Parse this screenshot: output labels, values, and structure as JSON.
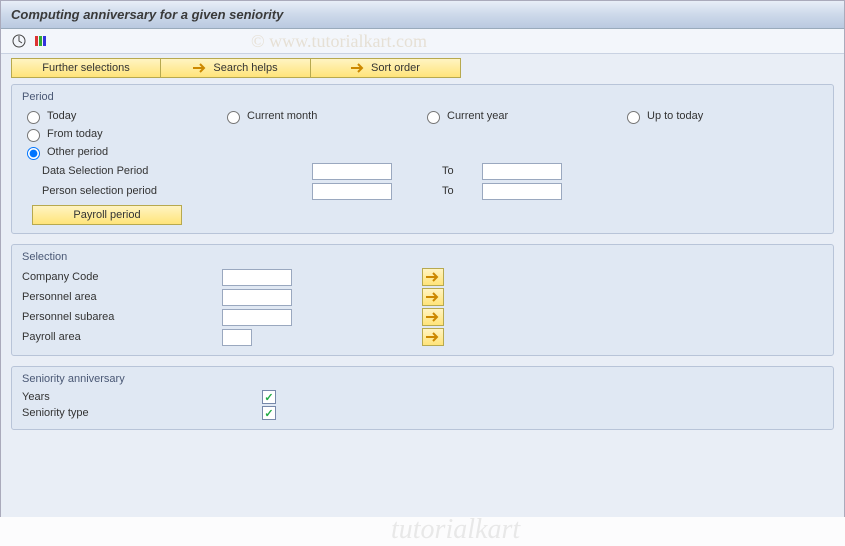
{
  "title": "Computing anniversary for a given seniority",
  "watermark": "© www.tutorialkart.com",
  "watermark2": "tutorialkart",
  "toolbar": {
    "further_selections": "Further selections",
    "search_helps": "Search helps",
    "sort_order": "Sort order"
  },
  "period": {
    "title": "Period",
    "today": "Today",
    "current_month": "Current month",
    "current_year": "Current year",
    "up_to_today": "Up to today",
    "from_today": "From today",
    "other_period": "Other period",
    "data_selection_period": "Data Selection Period",
    "person_selection_period": "Person selection period",
    "to": "To",
    "payroll_period": "Payroll period"
  },
  "selection": {
    "title": "Selection",
    "company_code": "Company Code",
    "personnel_area": "Personnel area",
    "personnel_subarea": "Personnel subarea",
    "payroll_area": "Payroll area"
  },
  "seniority": {
    "title": "Seniority anniversary",
    "years": "Years",
    "seniority_type": "Seniority type"
  }
}
